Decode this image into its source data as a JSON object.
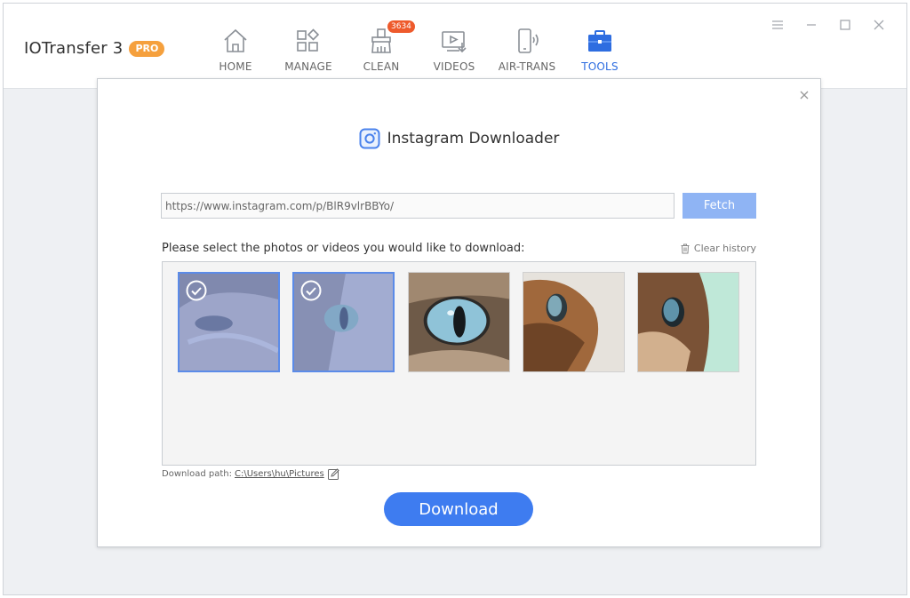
{
  "app": {
    "name": "IOTransfer 3",
    "badge": "PRO"
  },
  "nav": [
    {
      "id": "home",
      "label": "HOME",
      "icon": "home-icon"
    },
    {
      "id": "manage",
      "label": "MANAGE",
      "icon": "grid-icon"
    },
    {
      "id": "clean",
      "label": "CLEAN",
      "icon": "broom-icon",
      "badge": "3634"
    },
    {
      "id": "videos",
      "label": "VIDEOS",
      "icon": "video-download-icon"
    },
    {
      "id": "air-trans",
      "label": "AIR-TRANS",
      "icon": "phone-wireless-icon"
    },
    {
      "id": "tools",
      "label": "TOOLS",
      "icon": "toolbox-icon",
      "active": true
    }
  ],
  "dialog": {
    "title": "Instagram Downloader",
    "url_value": "https://www.instagram.com/p/BlR9vlrBBYo/",
    "fetch_label": "Fetch",
    "select_prompt": "Please select the photos or videos you would like to download:",
    "clear_history": "Clear history",
    "thumbnails": [
      {
        "selected": true
      },
      {
        "selected": true
      },
      {
        "selected": false
      },
      {
        "selected": false
      },
      {
        "selected": false
      }
    ],
    "download_path_label": "Download path:",
    "download_path": "C:\\Users\\hu\\Pictures",
    "download_label": "Download"
  },
  "colors": {
    "accent": "#3e7cf0",
    "fetch": "#8fb4f4",
    "badge": "#ee5a2c",
    "pro": "#f5a03d"
  }
}
